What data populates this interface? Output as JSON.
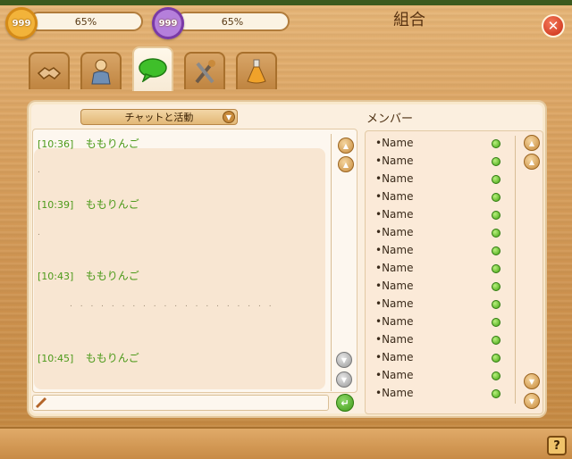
{
  "header": {
    "stat1": {
      "level": "999",
      "percent": "65%"
    },
    "stat2": {
      "level": "999",
      "percent": "65%"
    },
    "title": "組合",
    "close_icon": "close-icon"
  },
  "tabs": [
    {
      "icon": "handshake-icon",
      "active": false
    },
    {
      "icon": "member-icon",
      "active": false
    },
    {
      "icon": "chat-bubble-icon",
      "active": true
    },
    {
      "icon": "tools-icon",
      "active": false
    },
    {
      "icon": "potion-icon",
      "active": false
    }
  ],
  "chat": {
    "filter_label": "チャットと活動",
    "messages": [
      {
        "time": "[10:36]",
        "name": "ももりんご"
      },
      {
        "time": "[10:39]",
        "name": "ももりんご"
      },
      {
        "time": "[10:43]",
        "name": "ももりんご"
      },
      {
        "time": "[10:45]",
        "name": "ももりんご"
      }
    ]
  },
  "members": {
    "title": "メンバー",
    "list": [
      "•Name",
      "•Name",
      "•Name",
      "•Name",
      "•Name",
      "•Name",
      "•Name",
      "•Name",
      "•Name",
      "•Name",
      "•Name",
      "•Name",
      "•Name",
      "•Name",
      "•Name"
    ]
  },
  "help_label": "?",
  "colors": {
    "online": "#44a514",
    "time_text": "#4c9a1a",
    "wood": "#d9a15f"
  }
}
